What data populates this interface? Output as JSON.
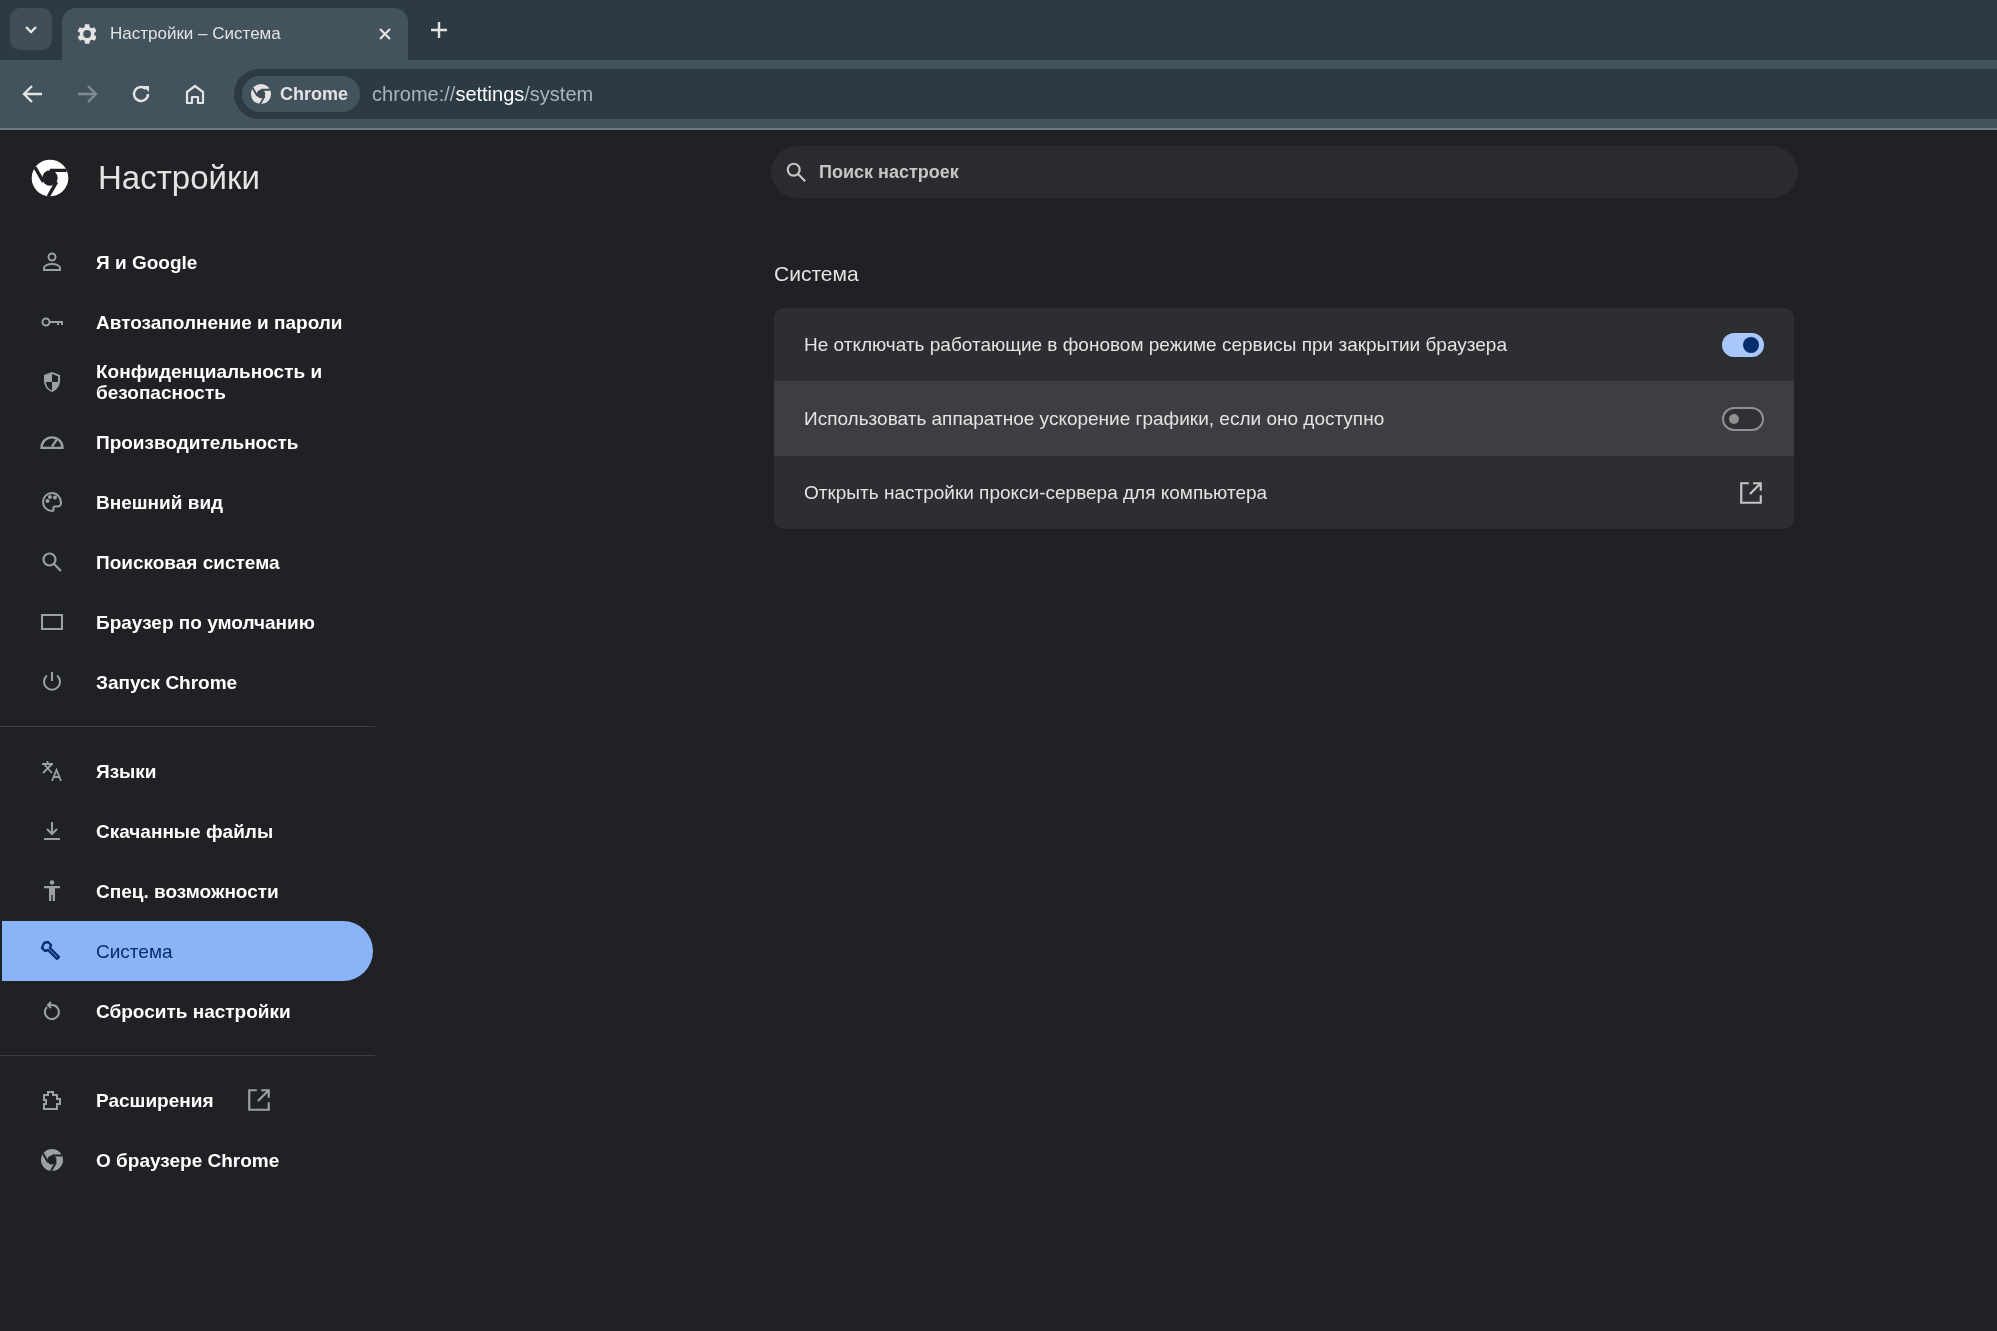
{
  "tab_strip": {
    "tabs": [
      {
        "title": "Настройки – Система",
        "selected": true
      }
    ]
  },
  "toolbar": {
    "forward_disabled": true,
    "chip": "Chrome",
    "url": {
      "scheme": "chrome://",
      "host": "settings",
      "path": "/system"
    }
  },
  "sidebar": {
    "title": "Настройки",
    "groups": [
      [
        {
          "label": "Я и Google",
          "selected": false
        },
        {
          "label": "Автозаполнение и пароли",
          "selected": false
        },
        {
          "label": "Конфиденциальность и безопасность",
          "selected": false
        },
        {
          "label": "Производительность",
          "selected": false
        },
        {
          "label": "Внешний вид",
          "selected": false
        },
        {
          "label": "Поисковая система",
          "selected": false
        },
        {
          "label": "Браузер по умолчанию",
          "selected": false
        },
        {
          "label": "Запуск Chrome",
          "selected": false
        }
      ],
      [
        {
          "label": "Языки",
          "selected": false
        },
        {
          "label": "Скачанные файлы",
          "selected": false
        },
        {
          "label": "Спец. возможности",
          "selected": false
        },
        {
          "label": "Система",
          "selected": true
        },
        {
          "label": "Сбросить настройки",
          "selected": false
        }
      ],
      [
        {
          "label": "Расширения",
          "selected": false,
          "external": true
        },
        {
          "label": "О браузере Chrome",
          "selected": false,
          "external": false
        }
      ]
    ]
  },
  "search": {
    "placeholder": "Поиск настроек"
  },
  "section": {
    "title": "Система",
    "rows": [
      {
        "kind": "toggle",
        "label": "Не отключать работающие в фоновом режиме сервисы при закрытии браузера",
        "on": true,
        "hovered": false
      },
      {
        "kind": "toggle",
        "label": "Использовать аппаратное ускорение графики, если оно доступно",
        "on": false,
        "hovered": true
      },
      {
        "kind": "link",
        "label": "Открыть настройки прокси-сервера для компьютера",
        "hovered": false
      }
    ]
  }
}
